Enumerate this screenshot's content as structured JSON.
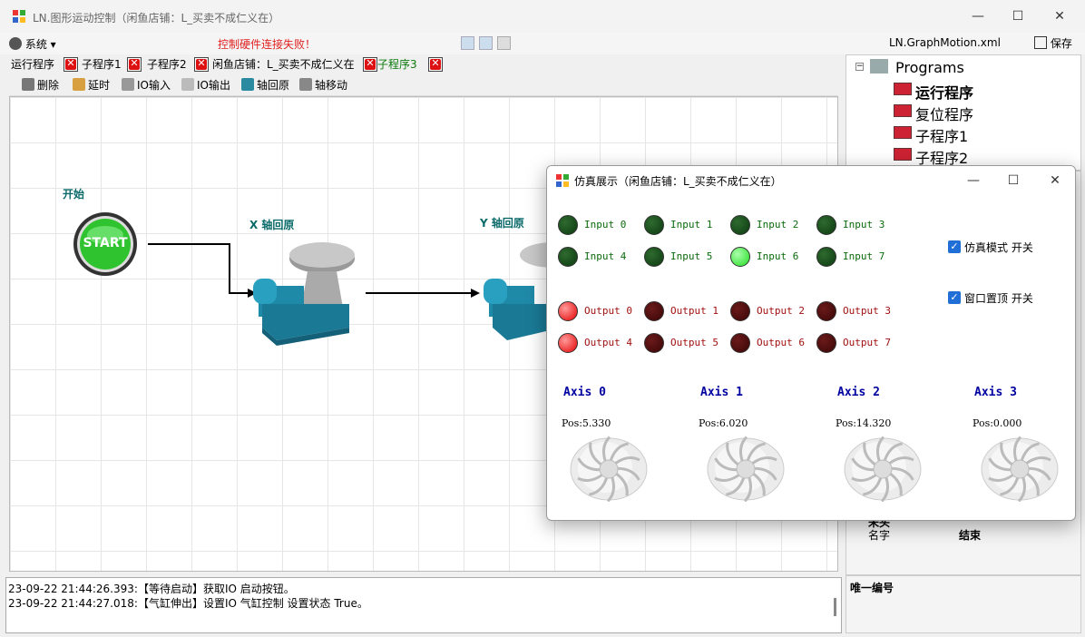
{
  "window": {
    "title": "LN.图形运动控制（闲鱼店铺：L_买卖不成仁义在）",
    "minimize": "—",
    "maximize": "☐",
    "close": "✕"
  },
  "menu": {
    "system_label": "系统",
    "error_text": "控制硬件连接失败！",
    "filename": "LN.GraphMotion.xml",
    "save_label": "保存"
  },
  "tabs": [
    "运行程序",
    "子程序1",
    "子程序2",
    "闲鱼店铺：L_买卖不成仁义在",
    "子程序3"
  ],
  "toolbar": {
    "delete": "删除",
    "delay": "延时",
    "io_input": "IO输入",
    "io_output": "IO输出",
    "axis_home": "轴回原",
    "axis_move": "轴移动"
  },
  "canvas": {
    "start_label": "开始",
    "start_button": "START",
    "node1_label": "X 轴回原",
    "node2_label": "Y 轴回原"
  },
  "tree": {
    "root": "Programs",
    "items": [
      "运行程序",
      "复位程序",
      "子程序1",
      "子程序2"
    ]
  },
  "props": {
    "name_label": "名字",
    "name_value": "结束",
    "partial": "未头"
  },
  "unique_label": "唯一编号",
  "log": [
    "23-09-22 21:44:26.393:【等待启动】获取IO 启动按钮。",
    "23-09-22 21:44:27.018:【气缸伸出】设置IO 气缸控制 设置状态 True。"
  ],
  "sim": {
    "title": "仿真展示（闲鱼店铺：L_买卖不成仁义在）",
    "inputs": [
      {
        "label": "Input 0",
        "on": false
      },
      {
        "label": "Input 1",
        "on": false
      },
      {
        "label": "Input 2",
        "on": false
      },
      {
        "label": "Input 3",
        "on": false
      },
      {
        "label": "Input 4",
        "on": false
      },
      {
        "label": "Input 5",
        "on": false
      },
      {
        "label": "Input 6",
        "on": true
      },
      {
        "label": "Input 7",
        "on": false
      }
    ],
    "outputs": [
      {
        "label": "Output 0",
        "on": true
      },
      {
        "label": "Output 1",
        "on": false
      },
      {
        "label": "Output 2",
        "on": false
      },
      {
        "label": "Output 3",
        "on": false
      },
      {
        "label": "Output 4",
        "on": true
      },
      {
        "label": "Output 5",
        "on": false
      },
      {
        "label": "Output 6",
        "on": false
      },
      {
        "label": "Output 7",
        "on": false
      }
    ],
    "sim_mode_label": "仿真模式 开关",
    "topmost_label": "窗口置顶 开关",
    "axes": [
      {
        "title": "Axis 0",
        "pos": "Pos:5.330"
      },
      {
        "title": "Axis 1",
        "pos": "Pos:6.020"
      },
      {
        "title": "Axis 2",
        "pos": "Pos:14.320"
      },
      {
        "title": "Axis 3",
        "pos": "Pos:0.000"
      }
    ]
  },
  "colors": {
    "error": "#e02020",
    "node_label": "#0a6a6a",
    "axis_title": "#0000a0"
  }
}
